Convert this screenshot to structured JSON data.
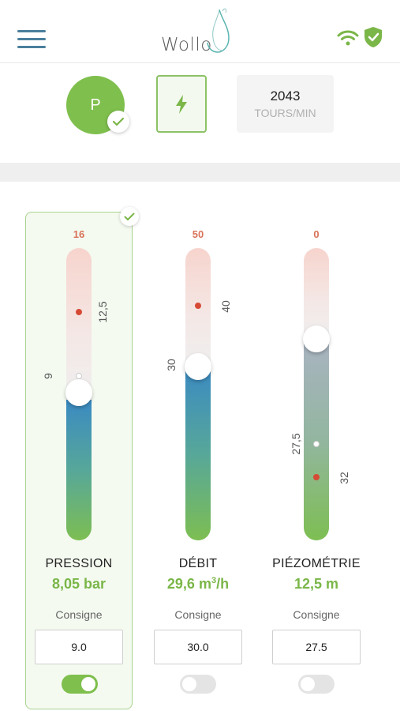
{
  "header": {
    "logo_text": "Wollo",
    "icons": [
      "menu-icon",
      "wifi-icon",
      "shield-check-icon"
    ],
    "accent_color": "#7fbf4d"
  },
  "modes": {
    "pressure_mode_label": "P",
    "pressure_mode_selected": true,
    "power_mode_icon": "lightning-bolt-icon",
    "rpm_value": "2043",
    "rpm_unit": "TOURS/MIN"
  },
  "meters": [
    {
      "title": "PRESSION",
      "value": "8,05 bar",
      "max": "16",
      "current_level": 0.48,
      "marker_red": "12,5",
      "marker_white": "9",
      "consigne_label": "Consigne",
      "consigne_value": "9.0",
      "toggle_on": true,
      "selected": true
    },
    {
      "title": "DÉBIT",
      "value_number": "29,6 m",
      "value_sup": "3",
      "value_unit": "/h",
      "max": "50",
      "current_level": 0.59,
      "marker_red": "40",
      "marker_white": "30",
      "consigne_label": "Consigne",
      "consigne_value": "30.0",
      "toggle_on": false,
      "selected": false
    },
    {
      "title": "PIÉZOMÉTRIE",
      "value": "12,5 m",
      "max": "0",
      "current_level": 0.69,
      "marker_red": "32",
      "marker_white": "27,5",
      "consigne_label": "Consigne",
      "consigne_value": "27.5",
      "toggle_on": false,
      "selected": false
    }
  ]
}
